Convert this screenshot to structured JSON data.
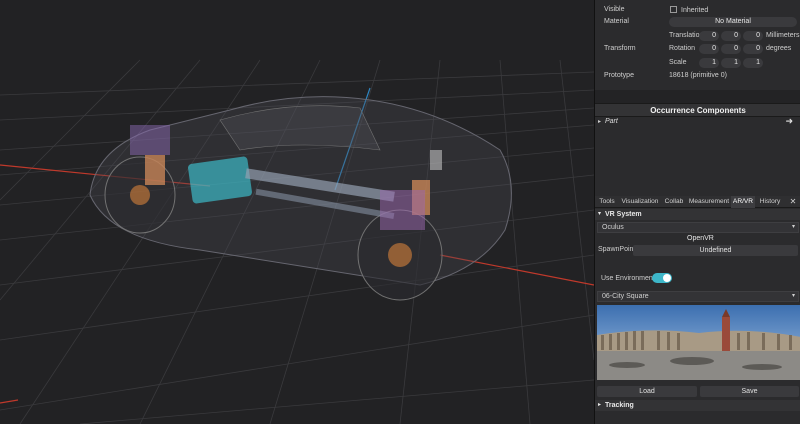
{
  "properties": {
    "visible_label": "Visible",
    "inherited_label": "Inherited",
    "material_label": "Material",
    "material_value": "No Material",
    "transform_label": "Transform",
    "translation_label": "Translation",
    "translation": [
      "0",
      "0",
      "0"
    ],
    "translation_unit": "Millimeters",
    "rotation_label": "Rotation",
    "rotation": [
      "0",
      "0",
      "0"
    ],
    "rotation_unit": "degrees",
    "scale_label": "Scale",
    "scale": [
      "1",
      "1",
      "1"
    ],
    "prototype_label": "Prototype",
    "prototype_value": "18618 (primitive 0)"
  },
  "occurrence": {
    "title": "Occurrence Components",
    "item_label": "Part"
  },
  "tabs": [
    "Tools",
    "Visualization",
    "Collab",
    "Measurement",
    "AR/VR",
    "History"
  ],
  "active_tab": "AR/VR",
  "vr": {
    "section_label": "VR System",
    "device_value": "Oculus",
    "openvr_label": "OpenVR",
    "spawnpoint_label": "SpawnPoint",
    "spawnpoint_value": "Undefined",
    "use_env_label": "Use Environment",
    "environment_value": "06-City Square",
    "load_label": "Load",
    "save_label": "Save",
    "tracking_label": "Tracking"
  },
  "colors": {
    "accent": "#3db6c8",
    "axis_x": "#c0392b",
    "axis_y": "#2e86c1"
  }
}
